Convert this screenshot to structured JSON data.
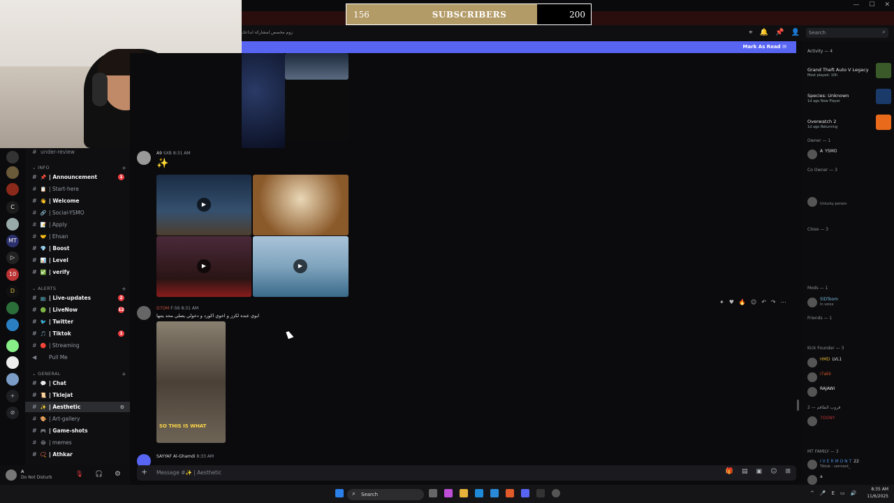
{
  "window": {
    "controls": [
      "—",
      "☐",
      "✕"
    ]
  },
  "overlay": {
    "subs_current": "156",
    "subs_label": "SUBSCRIBERS",
    "subs_goal": "200",
    "subs_progress": 0.78
  },
  "topbar": {
    "channel_description": "زوم مخصص لمشاركة ابداعك",
    "search_placeholder": "Search"
  },
  "banner": {
    "mark_as_read": "Mark As Read"
  },
  "sidebar": {
    "partial_top": "under-review",
    "categories": {
      "info": "INFO",
      "alerts": "ALERTS",
      "general": "GENERAL"
    },
    "info_channels": [
      {
        "emoji": "📌",
        "label": "| Announcement",
        "badge": "1",
        "bright": true
      },
      {
        "emoji": "📋",
        "label": "| Start-here",
        "bright": false
      },
      {
        "emoji": "👋",
        "label": "| Welcome",
        "bright": true
      },
      {
        "emoji": "🔗",
        "label": "| Social-YSMO",
        "bright": false
      },
      {
        "emoji": "📝",
        "label": "| Apply",
        "bright": false
      },
      {
        "emoji": "🤝",
        "label": "| Ehsan",
        "bright": false
      },
      {
        "emoji": "💎",
        "label": "| Boost",
        "bright": true
      },
      {
        "emoji": "📊",
        "label": "| Level",
        "bright": true
      },
      {
        "emoji": "✅",
        "label": "| verify",
        "bright": true
      }
    ],
    "alert_channels": [
      {
        "emoji": "📺",
        "label": "| Live-updates",
        "badge": "2",
        "bright": true
      },
      {
        "emoji": "🟢",
        "label": "| LiveNow",
        "badge": "12",
        "bright": true
      },
      {
        "emoji": "🐦",
        "label": "| Twitter",
        "bright": true
      },
      {
        "emoji": "🎵",
        "label": "| Tiktok",
        "badge": "1",
        "bright": true
      },
      {
        "emoji": "🔴",
        "label": "| Streaming",
        "bright": false
      },
      {
        "emoji": "",
        "label": "Pull Me",
        "bright": false
      }
    ],
    "general_channels": [
      {
        "emoji": "💬",
        "label": "| Chat",
        "bright": true
      },
      {
        "emoji": "📜",
        "label": "| Tklejat",
        "bright": true
      },
      {
        "emoji": "✨",
        "label": "| Aesthetic",
        "bright": true,
        "selected": true
      },
      {
        "emoji": "🎨",
        "label": "| Art-gallery",
        "bright": false
      },
      {
        "emoji": "🎮",
        "label": "| Game-shots",
        "bright": true
      },
      {
        "emoji": "😂",
        "label": "| memes",
        "bright": false
      },
      {
        "emoji": "📿",
        "label": "| Athkar",
        "bright": true
      }
    ]
  },
  "user": {
    "name": "A",
    "status": "Do Not Disturb"
  },
  "messages": [
    {
      "author": "A9",
      "tag": "SXB",
      "time": "8:31 AM",
      "content": "✨"
    },
    {
      "author": "D7OM",
      "tag": "F-56",
      "time": "8:31 AM",
      "content": "ابوي عنده لكزز و اخوي اكورد و دخولي يصلي محد يتنها"
    },
    {
      "author": "SAYYAF Al-Ghamdi",
      "time": "8:33 AM"
    }
  ],
  "video_overlay_text": "SO THIS IS WHAT",
  "composer": {
    "placeholder": "Message #✨ | Aesthetic"
  },
  "right_panel": {
    "activity_header": "Activity — 4",
    "activities": [
      {
        "game": "Grand Theft Auto V Legacy",
        "sub": "Most played: 10h"
      },
      {
        "game": "Species: Unknown",
        "sub": "1d ago  New Player"
      },
      {
        "game": "Overwatch 2",
        "sub": "1d ago  Returning"
      }
    ],
    "groups": [
      {
        "label": "Owner — 1"
      },
      {
        "label": "Co Owner — 3"
      },
      {
        "label": "Close — 3"
      },
      {
        "label": "Mods — 1"
      },
      {
        "label": "Friends — 1"
      },
      {
        "label": "Kick Founder — 3"
      },
      {
        "label": "قروب الطاقم — 2"
      },
      {
        "label": "MT FAMILY — 3"
      }
    ],
    "members": [
      {
        "name": "A",
        "tag": "YSMO"
      },
      {
        "name": "",
        "status": "Unlucky person"
      },
      {
        "name": "5lDToom",
        "status": "In voice"
      },
      {
        "name": "HMD",
        "tag": "LVL1"
      },
      {
        "name": "i7aliii"
      },
      {
        "name": "RAJAWI"
      },
      {
        "name": "7OONY"
      },
      {
        "name": "I V E R M O N T",
        "tag": "22",
        "status": "Tiktok : vermont_"
      },
      {
        "name": "a"
      }
    ]
  },
  "taskbar": {
    "search": "Search",
    "time": "8:35 AM",
    "date": "11/6/2025"
  },
  "colors": {
    "accent": "#5865f2",
    "overlay_gold": "#b39b68",
    "mention_red": "#f23f43"
  }
}
